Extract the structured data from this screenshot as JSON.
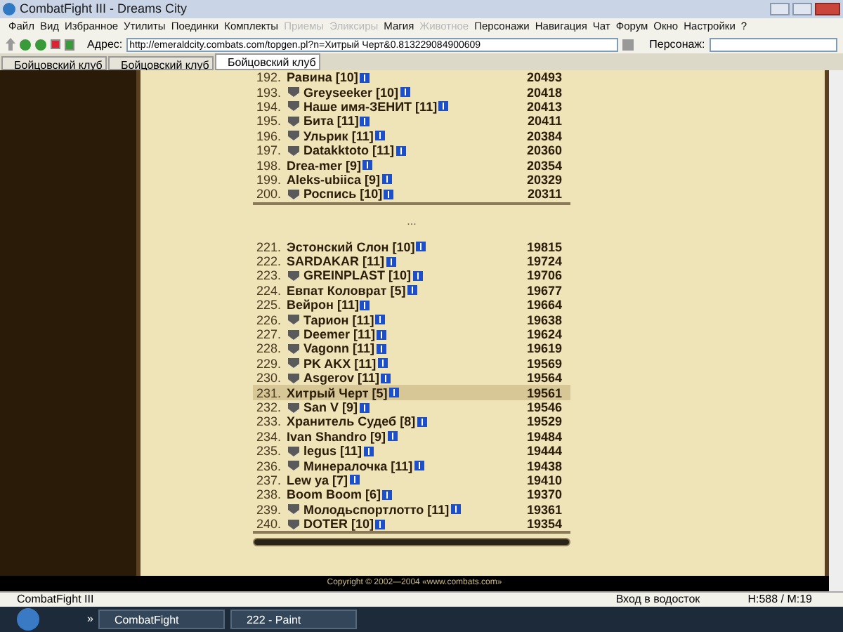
{
  "window": {
    "title": "CombatFight III - Dreams City"
  },
  "menu": [
    {
      "label": "Файл",
      "disabled": false
    },
    {
      "label": "Вид",
      "disabled": false
    },
    {
      "label": "Избранное",
      "disabled": false
    },
    {
      "label": "Утилиты",
      "disabled": false
    },
    {
      "label": "Поединки",
      "disabled": false
    },
    {
      "label": "Комплекты",
      "disabled": false
    },
    {
      "label": "Приемы",
      "disabled": true
    },
    {
      "label": "Эликсиры",
      "disabled": true
    },
    {
      "label": "Магия",
      "disabled": false
    },
    {
      "label": "Животное",
      "disabled": true
    },
    {
      "label": "Персонажи",
      "disabled": false
    },
    {
      "label": "Навигация",
      "disabled": false
    },
    {
      "label": "Чат",
      "disabled": false
    },
    {
      "label": "Форум",
      "disabled": false
    },
    {
      "label": "Окно",
      "disabled": false
    },
    {
      "label": "Настройки",
      "disabled": false
    },
    {
      "label": "?",
      "disabled": false
    }
  ],
  "address_bar": {
    "label": "Адрес:",
    "value": "http://emeraldcity.combats.com/topgen.pl?n=Хитрый Черт&0.813229084900609",
    "character_label": "Персонаж:"
  },
  "tabs": [
    {
      "label": "Бойцовский клуб",
      "selected": false
    },
    {
      "label": "Бойцовский клуб",
      "selected": false
    },
    {
      "label": "Бойцовский клуб",
      "selected": true
    }
  ],
  "ranking": {
    "groups": [
      {
        "rows": [
          {
            "rank": "192.",
            "name": "Равина [10]",
            "score": "20493",
            "clan_icon": false,
            "selected": false
          },
          {
            "rank": "193.",
            "name": "Greyseeker [10]",
            "score": "20418",
            "clan_icon": true,
            "selected": false
          },
          {
            "rank": "194.",
            "name": "Наше имя-ЗЕНИТ [11]",
            "score": "20413",
            "clan_icon": true,
            "selected": false
          },
          {
            "rank": "195.",
            "name": "Бита [11]",
            "score": "20411",
            "clan_icon": true,
            "selected": false
          },
          {
            "rank": "196.",
            "name": "Ульрик [11]",
            "score": "20384",
            "clan_icon": true,
            "selected": false
          },
          {
            "rank": "197.",
            "name": "Datakktoto [11]",
            "score": "20360",
            "clan_icon": true,
            "selected": false
          },
          {
            "rank": "198.",
            "name": "Drea-mer [9]",
            "score": "20354",
            "clan_icon": false,
            "selected": false
          },
          {
            "rank": "199.",
            "name": "Aleks-ubiica [9]",
            "score": "20329",
            "clan_icon": false,
            "selected": false
          },
          {
            "rank": "200.",
            "name": "Роспись [10]",
            "score": "20311",
            "clan_icon": true,
            "selected": false
          }
        ]
      },
      {
        "rows": [
          {
            "rank": "221.",
            "name": "Эстонский Слон [10]",
            "score": "19815",
            "clan_icon": false,
            "selected": false
          },
          {
            "rank": "222.",
            "name": "SARDAKAR [11]",
            "score": "19724",
            "clan_icon": false,
            "selected": false
          },
          {
            "rank": "223.",
            "name": "GREINPLAST [10]",
            "score": "19706",
            "clan_icon": true,
            "selected": false
          },
          {
            "rank": "224.",
            "name": "Евпат Коловрат [5]",
            "score": "19677",
            "clan_icon": false,
            "selected": false
          },
          {
            "rank": "225.",
            "name": "Вейрон [11]",
            "score": "19664",
            "clan_icon": false,
            "selected": false
          },
          {
            "rank": "226.",
            "name": "Тарион [11]",
            "score": "19638",
            "clan_icon": true,
            "selected": false
          },
          {
            "rank": "227.",
            "name": "Deemer [11]",
            "score": "19624",
            "clan_icon": true,
            "selected": false
          },
          {
            "rank": "228.",
            "name": "Vagonn [11]",
            "score": "19619",
            "clan_icon": true,
            "selected": false
          },
          {
            "rank": "229.",
            "name": "PK AKX [11]",
            "score": "19569",
            "clan_icon": true,
            "selected": false
          },
          {
            "rank": "230.",
            "name": "Asgerov [11]",
            "score": "19564",
            "clan_icon": true,
            "selected": false
          },
          {
            "rank": "231.",
            "name": "Хитрый Черт [5]",
            "score": "19561",
            "clan_icon": false,
            "selected": true
          },
          {
            "rank": "232.",
            "name": "San V [9]",
            "score": "19546",
            "clan_icon": true,
            "selected": false
          },
          {
            "rank": "233.",
            "name": "Хранитель Судеб [8]",
            "score": "19529",
            "clan_icon": false,
            "selected": false
          },
          {
            "rank": "234.",
            "name": "Ivan Shandro [9]",
            "score": "19484",
            "clan_icon": false,
            "selected": false
          },
          {
            "rank": "235.",
            "name": "legus [11]",
            "score": "19444",
            "clan_icon": true,
            "selected": false
          },
          {
            "rank": "236.",
            "name": "Минералочка [11]",
            "score": "19438",
            "clan_icon": true,
            "selected": false
          },
          {
            "rank": "237.",
            "name": "Lew ya [7]",
            "score": "19410",
            "clan_icon": false,
            "selected": false
          },
          {
            "rank": "238.",
            "name": "Boom Boom [6]",
            "score": "19370",
            "clan_icon": false,
            "selected": false
          },
          {
            "rank": "239.",
            "name": "Молодьспортлотто [11]",
            "score": "19361",
            "clan_icon": true,
            "selected": false
          },
          {
            "rank": "240.",
            "name": "DOTER [10]",
            "score": "19354",
            "clan_icon": true,
            "selected": false
          }
        ]
      }
    ],
    "gap_text": "..."
  },
  "footer": {
    "copyright": "Copyright © 2002—2004 «www.combats.com»"
  },
  "status_bar": {
    "title": "CombatFight III",
    "location": "Вход в водосток",
    "stats": "H:588 / M:19"
  },
  "taskbar": {
    "more": "»",
    "items": [
      {
        "label": "CombatFight"
      },
      {
        "label": "222 - Paint"
      }
    ]
  }
}
